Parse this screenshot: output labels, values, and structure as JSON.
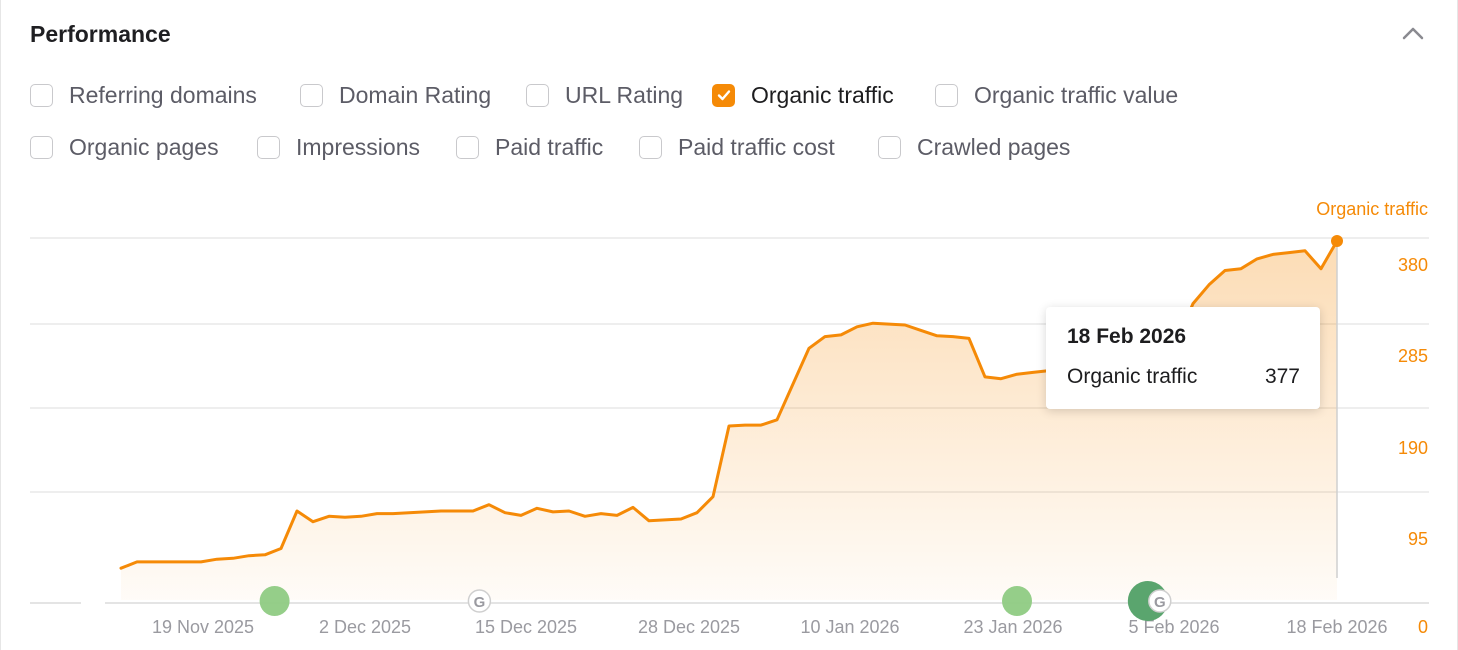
{
  "panel": {
    "title": "Performance"
  },
  "metrics": [
    {
      "label": "Referring domains",
      "checked": false
    },
    {
      "label": "Domain Rating",
      "checked": false
    },
    {
      "label": "URL Rating",
      "checked": false
    },
    {
      "label": "Organic traffic",
      "checked": true
    },
    {
      "label": "Organic traffic value",
      "checked": false
    },
    {
      "label": "Organic pages",
      "checked": false
    },
    {
      "label": "Impressions",
      "checked": false
    },
    {
      "label": "Paid traffic",
      "checked": false
    },
    {
      "label": "Paid traffic cost",
      "checked": false
    },
    {
      "label": "Crawled pages",
      "checked": false
    }
  ],
  "tooltip": {
    "date": "18 Feb 2026",
    "series": "Organic traffic",
    "value": "377"
  },
  "colors": {
    "accent": "#f58a07",
    "grid": "#e8e8e8",
    "axis_text": "#9a9aa0",
    "event_green": "#8fcb83",
    "event_green_dark": "#5aa56e"
  },
  "chart_data": {
    "type": "area",
    "series": [
      {
        "name": "Organic traffic",
        "values": [
          11,
          18,
          18,
          18,
          18,
          18,
          21,
          22,
          25,
          26,
          33,
          75,
          63,
          69,
          68,
          69,
          72,
          72,
          73,
          74,
          75,
          75,
          75,
          82,
          73,
          70,
          78,
          74,
          75,
          69,
          72,
          70,
          79,
          64,
          65,
          66,
          73,
          91,
          170,
          171,
          171,
          177,
          217,
          257,
          270,
          272,
          281,
          285,
          284,
          283,
          277,
          271,
          270,
          268,
          225,
          223,
          228,
          230,
          232,
          237,
          235,
          236,
          234,
          218,
          202,
          197,
          265,
          307,
          328,
          344,
          346,
          357,
          362,
          364,
          366,
          346,
          377
        ]
      }
    ],
    "x_start": "2025-11-15",
    "x_end": "2026-02-18",
    "x_ticks": [
      "19 Nov 2025",
      "2 Dec 2025",
      "15 Dec 2025",
      "28 Dec 2025",
      "10 Jan 2026",
      "23 Jan 2026",
      "5 Feb 2026",
      "18 Feb 2026"
    ],
    "y_ticks": [
      "0",
      "95",
      "190",
      "285",
      "380"
    ],
    "ylim": [
      0,
      380
    ],
    "series_label": "Organic traffic",
    "events": [
      {
        "date": "2025-11-27",
        "kind": "update"
      },
      {
        "date": "2025-12-13",
        "kind": "google-update"
      },
      {
        "date": "2026-01-24",
        "kind": "update"
      },
      {
        "date": "2026-02-04",
        "kind": "google-update"
      }
    ],
    "grid": true,
    "legend": "none"
  }
}
